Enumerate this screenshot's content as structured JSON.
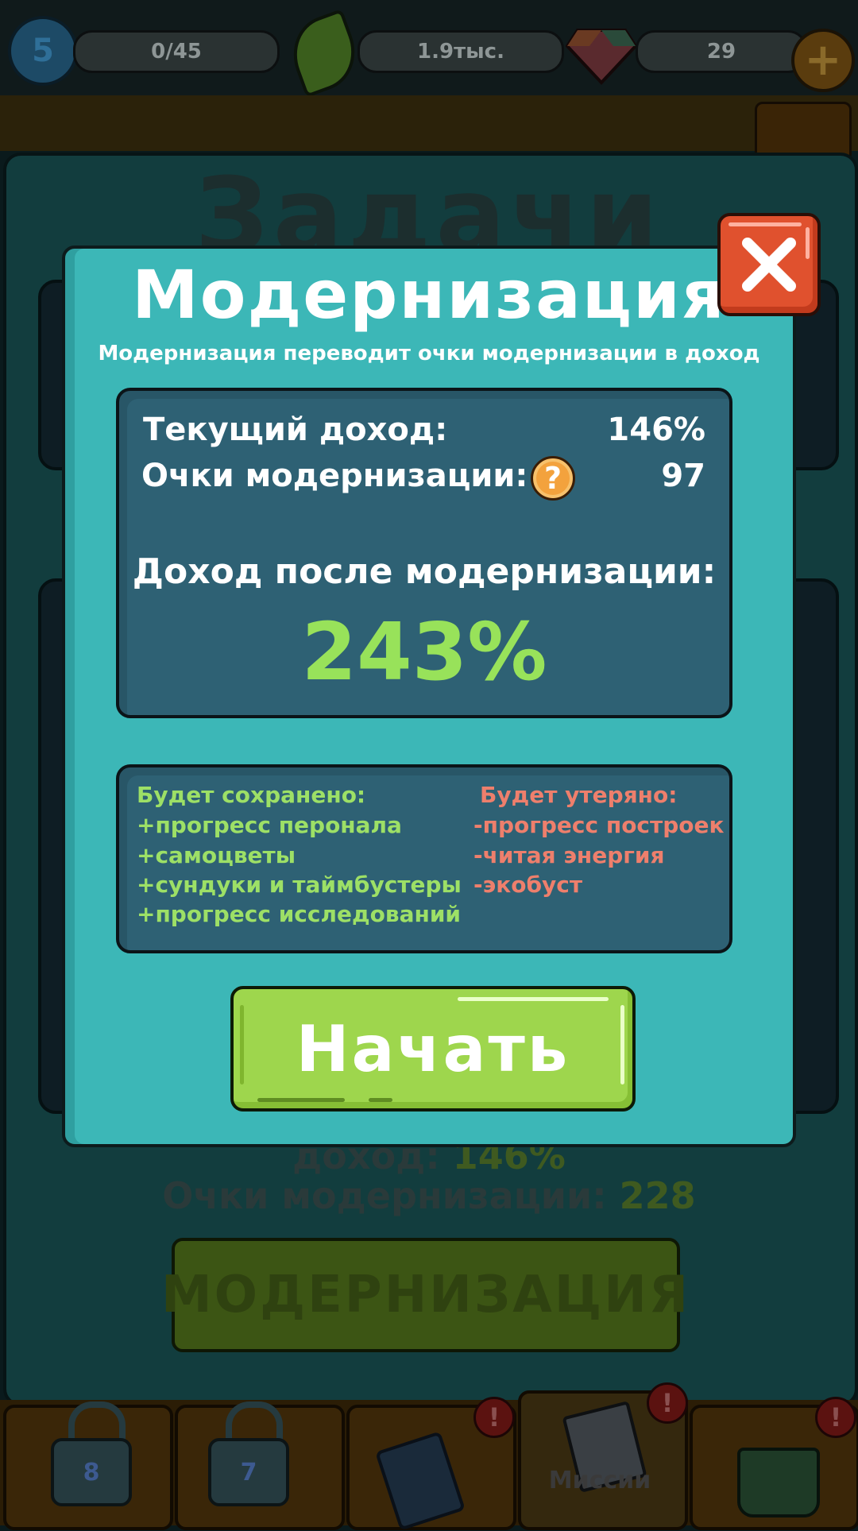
{
  "topbar": {
    "level": "5",
    "progress": "0/45",
    "leaves": "1.9тыс.",
    "gems": "29"
  },
  "background": {
    "panel_title": "Задачи",
    "income_label": "доход: ",
    "income_value": "146%",
    "points_label": "Очки модернизации: ",
    "points_value": "228",
    "modernize_button": "МОДЕРНИЗАЦИЯ"
  },
  "tabs": [
    {
      "lock_level": "8"
    },
    {
      "lock_level": "7"
    },
    {
      "alert": "!"
    },
    {
      "label": "Миссии",
      "alert": "!"
    },
    {
      "alert": "!"
    }
  ],
  "modal": {
    "title": "Модернизация",
    "subtitle": "Модернизация переводит очки  модернизации в доход",
    "current_income_label": "Текущий доход:",
    "current_income_value": "146%",
    "points_label": "Очки модернизации:",
    "points_value": "97",
    "help_icon": "?",
    "after_label": "Доход после модернизации:",
    "after_value": "243%",
    "kept_title": "Будет сохранено:",
    "kept": [
      "+прогресс перонала",
      "+самоцветы",
      "+сундуки и таймбустеры",
      "+прогресс исследований"
    ],
    "lost_title": "Будет утеряно:",
    "lost": [
      "-прогресс построек",
      "-читая энергия",
      "-экобуст"
    ],
    "start_button": "Начать",
    "close_icon": "close-x"
  },
  "colors": {
    "modal_bg": "#3cb7b7",
    "box_bg": "#2e6174",
    "accent_green": "#98e25a",
    "loss_red": "#ee7f6c",
    "close_red": "#e0512e",
    "button_green": "#9ed64d"
  }
}
